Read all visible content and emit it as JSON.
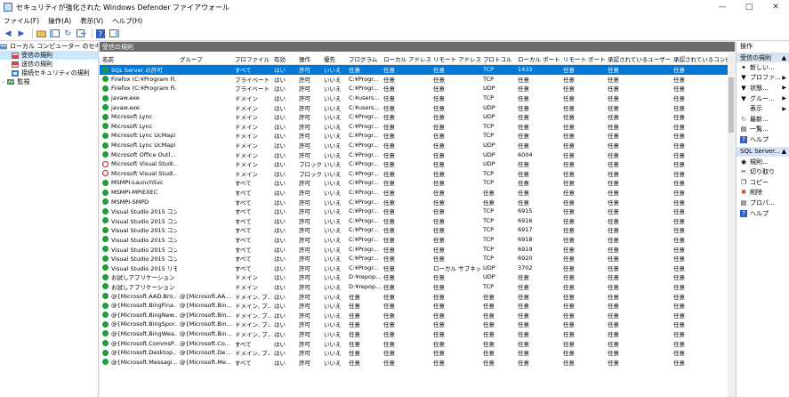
{
  "window": {
    "title": "セキュリティが強化された Windows Defender ファイアウォール"
  },
  "menu": [
    "ファイル(F)",
    "操作(A)",
    "表示(V)",
    "ヘルプ(H)"
  ],
  "tree": {
    "root": "ローカル コンピューター のセキュリティが強化された Windows Defender ファイアウォール",
    "items": [
      "受信の規則",
      "送信の規則",
      "接続セキュリティの規則",
      "監視"
    ]
  },
  "panel": {
    "title": "受信の規則"
  },
  "columns": [
    "名前",
    "グループ",
    "プロファイル",
    "有効",
    "操作",
    "優先",
    "プログラム",
    "ローカル アドレス",
    "リモート アドレス",
    "プロトコル",
    "ローカル ポート",
    "リモート ポート",
    "承認されているユーザー",
    "承認されているコンピュ"
  ],
  "rows": [
    {
      "status": "allow",
      "cells": [
        "SQL Server の許可",
        "",
        "すべて",
        "はい",
        "許可",
        "いいえ",
        "任意",
        "任意",
        "任意",
        "TCP",
        "1433",
        "任意",
        "任意",
        "任意"
      ]
    },
    {
      "status": "allow",
      "cells": [
        "Firefox (C:¥Program Fi...",
        "",
        "プライベート",
        "はい",
        "許可",
        "いいえ",
        "C:¥Progr...",
        "任意",
        "任意",
        "TCP",
        "任意",
        "任意",
        "任意",
        "任意"
      ]
    },
    {
      "status": "allow",
      "cells": [
        "Firefox (C:¥Program Fi...",
        "",
        "プライベート",
        "はい",
        "許可",
        "いいえ",
        "C:¥Progr...",
        "任意",
        "任意",
        "UDP",
        "任意",
        "任意",
        "任意",
        "任意"
      ]
    },
    {
      "status": "allow",
      "cells": [
        "javaw.exe",
        "",
        "ドメイン",
        "はい",
        "許可",
        "いいえ",
        "C:¥users...",
        "任意",
        "任意",
        "TCP",
        "任意",
        "任意",
        "任意",
        "任意"
      ]
    },
    {
      "status": "allow",
      "cells": [
        "javaw.exe",
        "",
        "ドメイン",
        "はい",
        "許可",
        "いいえ",
        "C:¥users...",
        "任意",
        "任意",
        "UDP",
        "任意",
        "任意",
        "任意",
        "任意"
      ]
    },
    {
      "status": "allow",
      "cells": [
        "Microsoft Lync",
        "",
        "ドメイン",
        "はい",
        "許可",
        "いいえ",
        "C:¥Progr...",
        "任意",
        "任意",
        "UDP",
        "任意",
        "任意",
        "任意",
        "任意"
      ]
    },
    {
      "status": "allow",
      "cells": [
        "Microsoft Lync",
        "",
        "ドメイン",
        "はい",
        "許可",
        "いいえ",
        "C:¥Progr...",
        "任意",
        "任意",
        "TCP",
        "任意",
        "任意",
        "任意",
        "任意"
      ]
    },
    {
      "status": "allow",
      "cells": [
        "Microsoft Lync UcMapi",
        "",
        "ドメイン",
        "はい",
        "許可",
        "いいえ",
        "C:¥Progr...",
        "任意",
        "任意",
        "TCP",
        "任意",
        "任意",
        "任意",
        "任意"
      ]
    },
    {
      "status": "allow",
      "cells": [
        "Microsoft Lync UcMapi",
        "",
        "ドメイン",
        "はい",
        "許可",
        "いいえ",
        "C:¥Progr...",
        "任意",
        "任意",
        "UDP",
        "任意",
        "任意",
        "任意",
        "任意"
      ]
    },
    {
      "status": "allow",
      "cells": [
        "Microsoft Office Outl...",
        "",
        "ドメイン",
        "はい",
        "許可",
        "いいえ",
        "C:¥Progr...",
        "任意",
        "任意",
        "UDP",
        "6004",
        "任意",
        "任意",
        "任意"
      ]
    },
    {
      "status": "block",
      "cells": [
        "Microsoft Visual Studi...",
        "",
        "ドメイン",
        "はい",
        "ブロック",
        "いいえ",
        "C:¥Progr...",
        "任意",
        "任意",
        "UDP",
        "任意",
        "任意",
        "任意",
        "任意"
      ]
    },
    {
      "status": "block",
      "cells": [
        "Microsoft Visual Studi...",
        "",
        "ドメイン",
        "はい",
        "ブロック",
        "いいえ",
        "C:¥Progr...",
        "任意",
        "任意",
        "TCP",
        "任意",
        "任意",
        "任意",
        "任意"
      ]
    },
    {
      "status": "allow",
      "cells": [
        "MSMPI-LaunchSvc",
        "",
        "すべて",
        "はい",
        "許可",
        "いいえ",
        "C:¥Progr...",
        "任意",
        "任意",
        "TCP",
        "任意",
        "任意",
        "任意",
        "任意"
      ]
    },
    {
      "status": "allow",
      "cells": [
        "MSMPI-MPIEXEC",
        "",
        "すべて",
        "はい",
        "許可",
        "いいえ",
        "C:¥Progr...",
        "任意",
        "任意",
        "任意",
        "任意",
        "任意",
        "任意",
        "任意"
      ]
    },
    {
      "status": "allow",
      "cells": [
        "MSMPI-SMPD",
        "",
        "すべて",
        "はい",
        "許可",
        "いいえ",
        "C:¥Progr...",
        "任意",
        "任意",
        "任意",
        "任意",
        "任意",
        "任意",
        "任意"
      ]
    },
    {
      "status": "allow",
      "cells": [
        "Visual Studio 2015 コン...",
        "",
        "すべて",
        "はい",
        "許可",
        "いいえ",
        "C:¥Progr...",
        "任意",
        "任意",
        "TCP",
        "6915",
        "任意",
        "任意",
        "任意"
      ]
    },
    {
      "status": "allow",
      "cells": [
        "Visual Studio 2015 コン...",
        "",
        "すべて",
        "はい",
        "許可",
        "いいえ",
        "C:¥Progr...",
        "任意",
        "任意",
        "TCP",
        "6916",
        "任意",
        "任意",
        "任意"
      ]
    },
    {
      "status": "allow",
      "cells": [
        "Visual Studio 2015 コン...",
        "",
        "すべて",
        "はい",
        "許可",
        "いいえ",
        "C:¥Progr...",
        "任意",
        "任意",
        "TCP",
        "6917",
        "任意",
        "任意",
        "任意"
      ]
    },
    {
      "status": "allow",
      "cells": [
        "Visual Studio 2015 コン...",
        "",
        "すべて",
        "はい",
        "許可",
        "いいえ",
        "C:¥Progr...",
        "任意",
        "任意",
        "TCP",
        "6918",
        "任意",
        "任意",
        "任意"
      ]
    },
    {
      "status": "allow",
      "cells": [
        "Visual Studio 2015 コン...",
        "",
        "すべて",
        "はい",
        "許可",
        "いいえ",
        "C:¥Progr...",
        "任意",
        "任意",
        "TCP",
        "6919",
        "任意",
        "任意",
        "任意"
      ]
    },
    {
      "status": "allow",
      "cells": [
        "Visual Studio 2015 コン...",
        "",
        "すべて",
        "はい",
        "許可",
        "いいえ",
        "C:¥Progr...",
        "任意",
        "任意",
        "TCP",
        "6920",
        "任意",
        "任意",
        "任意"
      ]
    },
    {
      "status": "allow",
      "cells": [
        "Visual Studio 2015 リモ...",
        "",
        "すべて",
        "はい",
        "許可",
        "いいえ",
        "C:¥Progr...",
        "任意",
        "ローカル サブネット",
        "UDP",
        "3702",
        "任意",
        "任意",
        "任意"
      ]
    },
    {
      "status": "allow",
      "cells": [
        "お試しアプリケーション（E...",
        "",
        "ドメイン",
        "はい",
        "許可",
        "いいえ",
        "D:¥repop...",
        "任意",
        "任意",
        "UDP",
        "任意",
        "任意",
        "任意",
        "任意"
      ]
    },
    {
      "status": "allow",
      "cells": [
        "お試しアプリケーション（E...",
        "",
        "ドメイン",
        "はい",
        "許可",
        "いいえ",
        "D:¥repop...",
        "任意",
        "任意",
        "TCP",
        "任意",
        "任意",
        "任意",
        "任意"
      ]
    },
    {
      "status": "allow",
      "cells": [
        "@{Microsoft.AAD.Bro...",
        "@{Microsoft.AA...",
        "ドメイン, プ...",
        "はい",
        "許可",
        "いいえ",
        "任意",
        "任意",
        "任意",
        "任意",
        "任意",
        "任意",
        "任意",
        "任意"
      ]
    },
    {
      "status": "allow",
      "cells": [
        "@{Microsoft.BingFina...",
        "@{Microsoft.Bin...",
        "ドメイン, プ...",
        "はい",
        "許可",
        "いいえ",
        "任意",
        "任意",
        "任意",
        "任意",
        "任意",
        "任意",
        "任意",
        "任意"
      ]
    },
    {
      "status": "allow",
      "cells": [
        "@{Microsoft.BingNew...",
        "@{Microsoft.Bin...",
        "ドメイン, プ...",
        "はい",
        "許可",
        "いいえ",
        "任意",
        "任意",
        "任意",
        "任意",
        "任意",
        "任意",
        "任意",
        "任意"
      ]
    },
    {
      "status": "allow",
      "cells": [
        "@{Microsoft.BingSpor...",
        "@{Microsoft.Bin...",
        "ドメイン, プ...",
        "はい",
        "許可",
        "いいえ",
        "任意",
        "任意",
        "任意",
        "任意",
        "任意",
        "任意",
        "任意",
        "任意"
      ]
    },
    {
      "status": "allow",
      "cells": [
        "@{Microsoft.BingWea...",
        "@{Microsoft.Bin...",
        "ドメイン, プ...",
        "はい",
        "許可",
        "いいえ",
        "任意",
        "任意",
        "任意",
        "任意",
        "任意",
        "任意",
        "任意",
        "任意"
      ]
    },
    {
      "status": "allow",
      "cells": [
        "@{Microsoft.CommsP...",
        "@{Microsoft.Co...",
        "すべて",
        "はい",
        "許可",
        "いいえ",
        "任意",
        "任意",
        "任意",
        "任意",
        "任意",
        "任意",
        "任意",
        "任意"
      ]
    },
    {
      "status": "allow",
      "cells": [
        "@{Microsoft.Desktop...",
        "@{Microsoft.De...",
        "ドメイン, プ...",
        "はい",
        "許可",
        "いいえ",
        "任意",
        "任意",
        "任意",
        "任意",
        "任意",
        "任意",
        "任意",
        "任意"
      ]
    },
    {
      "status": "allow",
      "cells": [
        "@{Microsoft.Messagi...",
        "@{Microsoft.Me...",
        "すべて",
        "はい",
        "許可",
        "いいえ",
        "任意",
        "任意",
        "任意",
        "任意",
        "任意",
        "任意",
        "任意",
        "任意"
      ]
    }
  ],
  "actions": {
    "header": "操作",
    "section1": "受信の規則",
    "items1": [
      "新しい...",
      "プロファ...",
      "状態...",
      "グルー...",
      "表示",
      "最新...",
      "一覧...",
      "ヘルプ"
    ],
    "section2": "SQL Server...",
    "items2": [
      "規則...",
      "切り取り",
      "コピー",
      "削除",
      "プロパ...",
      "ヘルプ"
    ]
  }
}
